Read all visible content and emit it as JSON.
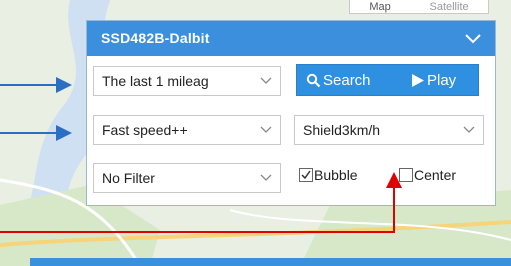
{
  "map": {
    "tabs": [
      "Map",
      "Satellite"
    ],
    "colors": {
      "land": "#e9efe2",
      "water": "#cfe0f3",
      "park": "#d7e8c8",
      "road": "#f6d47a"
    }
  },
  "panel": {
    "title": "SSD482B-Dalbit",
    "header_color": "#3b8fdc",
    "collapse_icon": "chevron-down-icon",
    "range_select": "The last 1 mileag",
    "speed_select": "Fast speed++",
    "shield_select": "Shield3km/h",
    "filter_select": "No Filter",
    "search_label": "Search",
    "play_label": "Play",
    "bubble_label": "Bubble",
    "bubble_checked": true,
    "center_label": "Center",
    "center_checked": false
  },
  "annotations": {
    "arrow_blue": "#2a6fc4",
    "arrow_red": "#e00000"
  }
}
